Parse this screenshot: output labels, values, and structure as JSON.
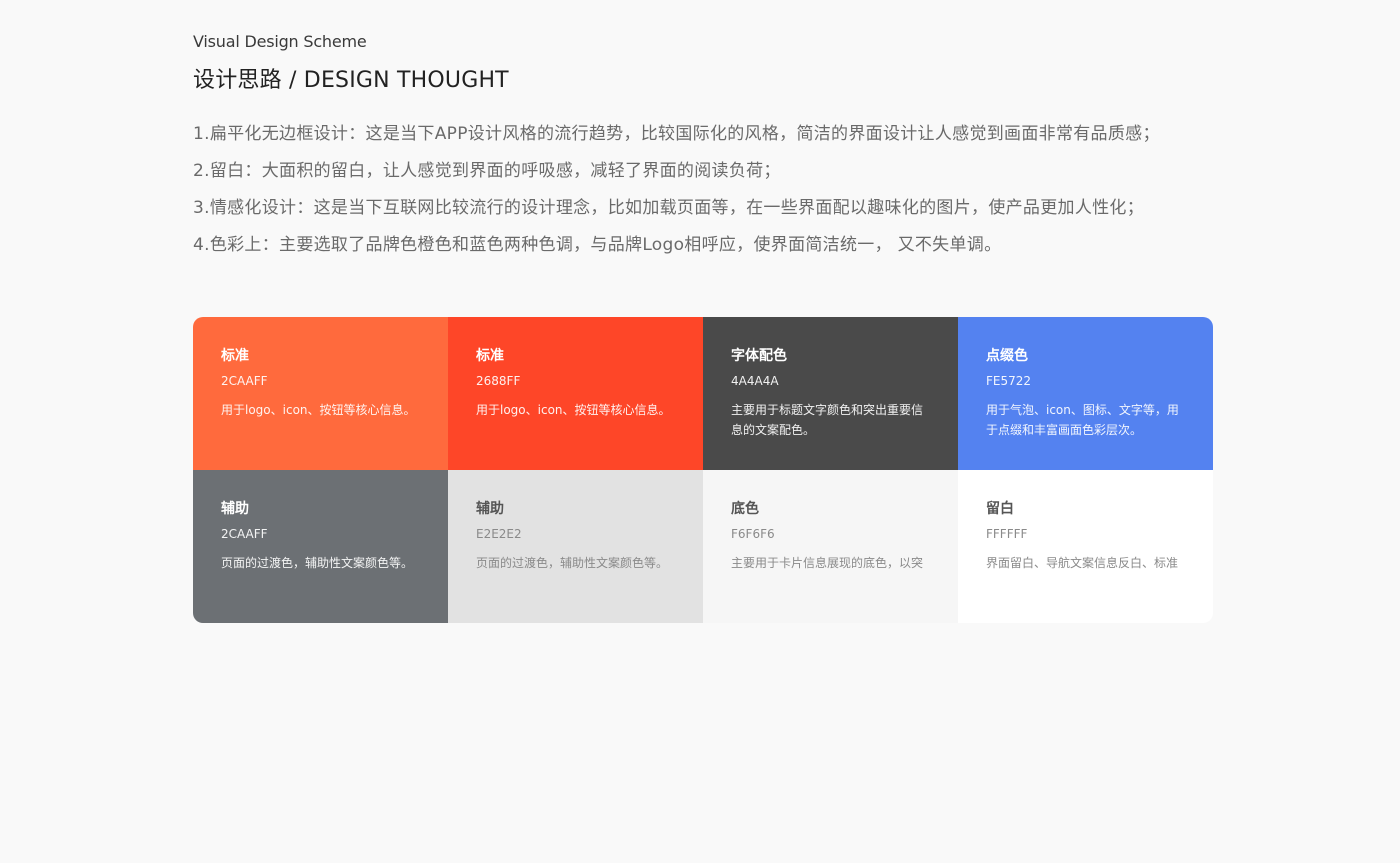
{
  "header": {
    "eyebrow": "Visual Design Scheme",
    "title": "设计思路 / DESIGN THOUGHT"
  },
  "points": [
    "1.扁平化无边框设计：这是当下APP设计风格的流行趋势，比较国际化的风格，简洁的界面设计让人感觉到画面非常有品质感；",
    "2.留白：大面积的留白，让人感觉到界面的呼吸感，减轻了界面的阅读负荷；",
    "3.情感化设计：这是当下互联网比较流行的设计理念，比如加载页面等，在一些界面配以趣味化的图片，使产品更加人性化；",
    "4.色彩上：主要选取了品牌色橙色和蓝色两种色调，与品牌Logo相呼应，使界面简洁统一，  又不失单调。"
  ],
  "palette": [
    {
      "name": "标准",
      "code": "2CAAFF",
      "desc": "用于logo、icon、按钮等核心信息。",
      "color": "#FF6A3D"
    },
    {
      "name": "标准",
      "code": "2688FF",
      "desc": "用于logo、icon、按钮等核心信息。",
      "color": "#FE4628"
    },
    {
      "name": "字体配色",
      "code": "4A4A4A",
      "desc": "主要用于标题文字颜色和突出重要信息的文案配色。",
      "color": "#4A4A4A"
    },
    {
      "name": "点缀色",
      "code": "FE5722",
      "desc": "用于气泡、icon、图标、文字等，用于点缀和丰富画面色彩层次。",
      "color": "#5482F0"
    },
    {
      "name": "辅助",
      "code": "2CAAFF",
      "desc": "页面的过渡色，辅助性文案颜色等。",
      "color": "#6C7074"
    },
    {
      "name": "辅助",
      "code": "E2E2E2",
      "desc": "页面的过渡色，辅助性文案颜色等。",
      "color": "#E2E2E2"
    },
    {
      "name": "底色",
      "code": "F6F6F6",
      "desc": "主要用于卡片信息展现的底色，以突",
      "color": "#F6F6F6"
    },
    {
      "name": "留白",
      "code": "FFFFFF",
      "desc": "界面留白、导航文案信息反白、标准",
      "color": "#FFFFFF"
    }
  ]
}
